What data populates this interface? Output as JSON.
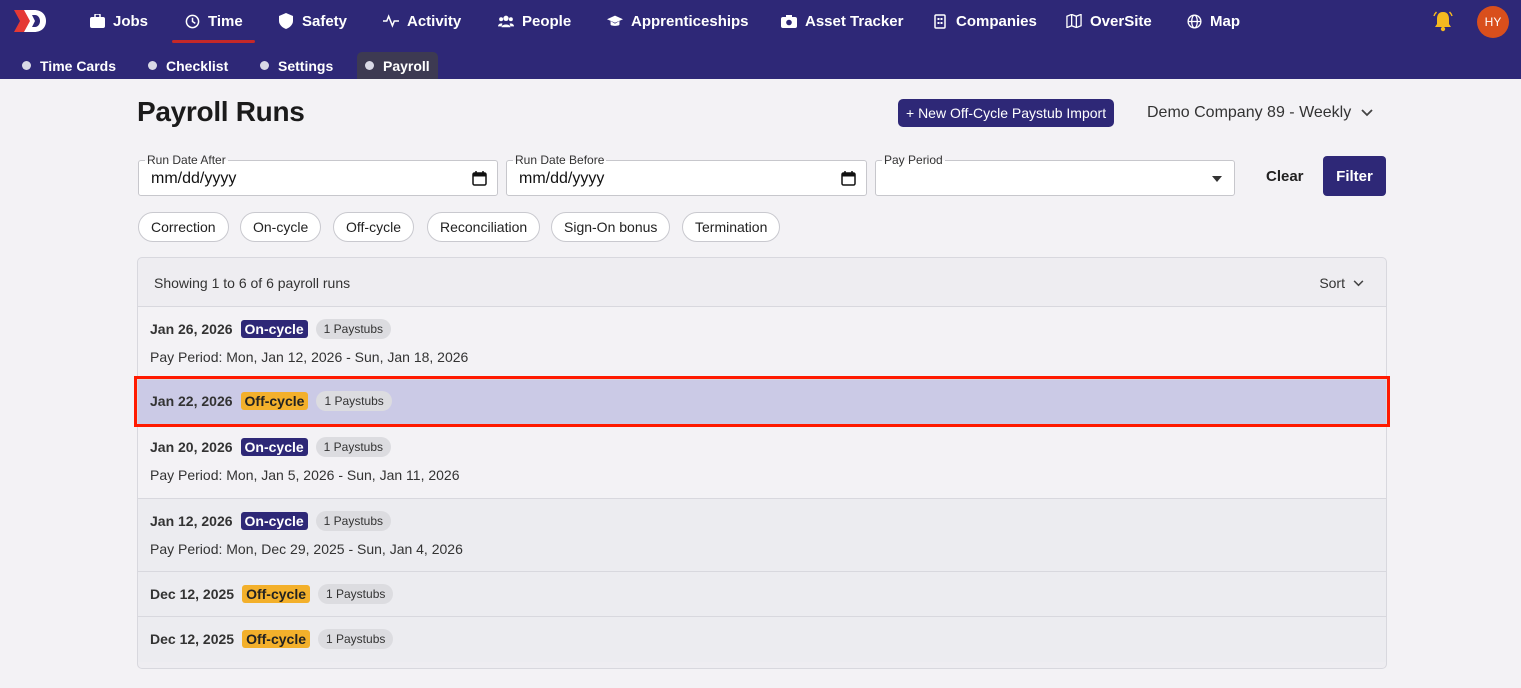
{
  "nav": {
    "items": [
      {
        "label": "Jobs",
        "icon": "briefcase-icon"
      },
      {
        "label": "Time",
        "icon": "clock-icon"
      },
      {
        "label": "Safety",
        "icon": "shield-icon"
      },
      {
        "label": "Activity",
        "icon": "activity-icon"
      },
      {
        "label": "People",
        "icon": "people-icon"
      },
      {
        "label": "Apprenticeships",
        "icon": "graduation-cap-icon"
      },
      {
        "label": "Asset Tracker",
        "icon": "camera-icon"
      },
      {
        "label": "Companies",
        "icon": "building-icon"
      },
      {
        "label": "OverSite",
        "icon": "map-icon"
      },
      {
        "label": "Map",
        "icon": "globe-icon"
      }
    ],
    "active": "Time",
    "avatar_initials": "HY"
  },
  "subnav": {
    "items": [
      {
        "label": "Time Cards"
      },
      {
        "label": "Checklist"
      },
      {
        "label": "Settings"
      },
      {
        "label": "Payroll"
      }
    ],
    "active": "Payroll"
  },
  "header": {
    "title": "Payroll Runs",
    "new_button": "+ New Off-Cycle Paystub Import",
    "company_select": "Demo Company 89 - Weekly"
  },
  "filters": {
    "run_date_after": {
      "label": "Run Date After",
      "value": "mm/dd/yyyy"
    },
    "run_date_before": {
      "label": "Run Date Before",
      "value": "mm/dd/yyyy"
    },
    "pay_period": {
      "label": "Pay Period",
      "value": ""
    },
    "clear_label": "Clear",
    "filter_label": "Filter",
    "chips": [
      "Correction",
      "On-cycle",
      "Off-cycle",
      "Reconciliation",
      "Sign-On bonus",
      "Termination"
    ]
  },
  "list": {
    "showing": "Showing 1 to 6 of 6 payroll runs",
    "sort_label": "Sort",
    "rows": [
      {
        "date": "Jan 26, 2026",
        "type": "On-cycle",
        "paystubs": "1 Paystubs",
        "period": "Pay Period: Mon, Jan 12, 2026 - Sun, Jan 18, 2026"
      },
      {
        "date": "Jan 22, 2026",
        "type": "Off-cycle",
        "paystubs": "1 Paystubs",
        "period": ""
      },
      {
        "date": "Jan 20, 2026",
        "type": "On-cycle",
        "paystubs": "1 Paystubs",
        "period": "Pay Period: Mon, Jan 5, 2026 - Sun, Jan 11, 2026"
      },
      {
        "date": "Jan 12, 2026",
        "type": "On-cycle",
        "paystubs": "1 Paystubs",
        "period": "Pay Period: Mon, Dec 29, 2025 - Sun, Jan 4, 2026"
      },
      {
        "date": "Dec 12, 2025",
        "type": "Off-cycle",
        "paystubs": "1 Paystubs",
        "period": ""
      },
      {
        "date": "Dec 12, 2025",
        "type": "Off-cycle",
        "paystubs": "1 Paystubs",
        "period": ""
      }
    ]
  },
  "colors": {
    "brand": "#2e2877",
    "off_cycle": "#f3b02b",
    "selected_row": "#cbcae6",
    "highlight": "#ff1a00"
  }
}
